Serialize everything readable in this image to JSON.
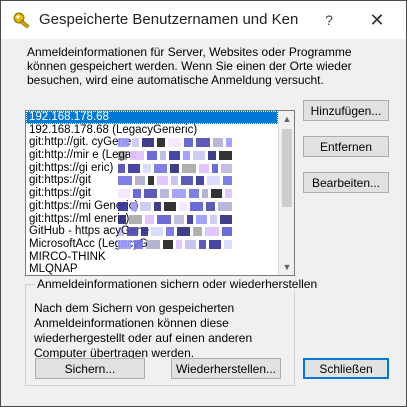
{
  "window": {
    "title": "Gespeicherte Benutzernamen und Ken...",
    "help_label": "?",
    "close_label": "✕"
  },
  "intro_text": "Anmeldeinformationen für Server, Websites oder Programme können gespeichert werden. Wenn Sie einen der Orte wieder besuchen, wird eine automatische Anmeldung versucht.",
  "list": {
    "items": [
      "192.168.178.68",
      "192.168.178.68 (LegacyGeneric)",
      "git:http://git.                            cyGene",
      "git:http://mir                              e (Legac",
      "git:https://gi                              eric)",
      "git:https://git",
      "git:https://git",
      "git:https://mi                              Generic)",
      "git:https://ml                              eneric)",
      "GitHub - https                              acyGene",
      "MicrosoftAcc                                 (LegacyG",
      "MIRCO-THINK",
      "MLQNAP"
    ],
    "selected_index": 0
  },
  "buttons": {
    "add": "Hinzufügen...",
    "remove": "Entfernen",
    "edit": "Bearbeiten...",
    "backup": "Sichern...",
    "restore": "Wiederherstellen...",
    "close": "Schließen"
  },
  "group": {
    "legend": "Anmeldeinformationen sichern oder wiederherstellen",
    "text": "Nach dem Sichern von gespeicherten Anmeldeinformationen können diese wiederhergestellt oder auf einen anderen Computer übertragen werden."
  },
  "icons": {
    "title": "key-icon",
    "scroll_up": "chevron-up-icon",
    "scroll_down": "chevron-down-icon"
  },
  "colors": {
    "selection": "#0078d7",
    "window_bg": "#f0f0f0"
  }
}
